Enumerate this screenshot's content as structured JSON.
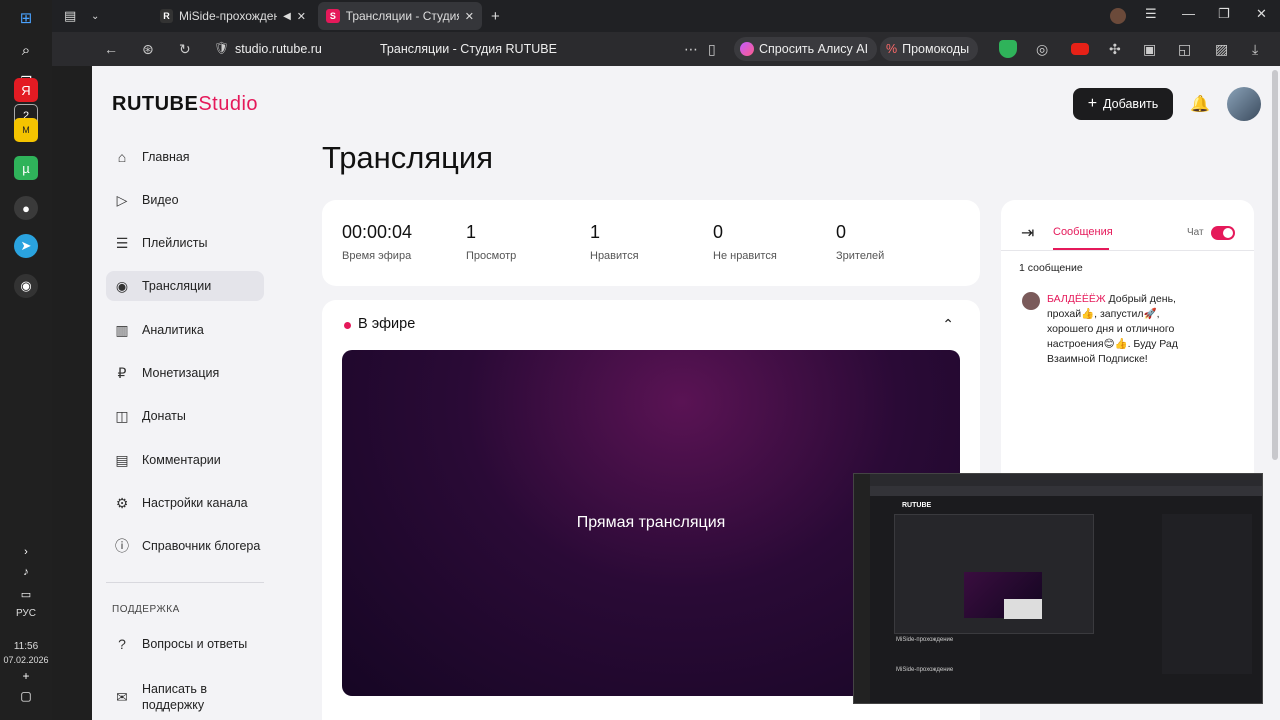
{
  "taskbar": {
    "clock_time": "11:56",
    "clock_date": "07.02.2026",
    "language": "РУС",
    "badge_count": "2"
  },
  "browser": {
    "tabs": [
      {
        "label": "MiSide-прохождение",
        "favicon": "R",
        "active": false
      },
      {
        "label": "Трансляции - Студия RUTUBE",
        "favicon": "S",
        "active": true
      }
    ],
    "url": "studio.rutube.ru",
    "page_title": "Трансляции - Студия RUTUBE",
    "alice_label": "Спросить Алису AI",
    "promo_label": "Промокоды"
  },
  "studio": {
    "logo_main": "RUTUBE",
    "logo_accent": "Studio",
    "add_button": "Добавить",
    "menu": [
      {
        "label": "Главная",
        "icon": "home-icon",
        "glyph": "⌂"
      },
      {
        "label": "Видео",
        "icon": "video-icon",
        "glyph": "▷"
      },
      {
        "label": "Плейлисты",
        "icon": "playlist-icon",
        "glyph": "☰"
      },
      {
        "label": "Трансляции",
        "icon": "broadcast-icon",
        "glyph": "◉",
        "active": true
      },
      {
        "label": "Аналитика",
        "icon": "analytics-icon",
        "glyph": "▥"
      },
      {
        "label": "Монетизация",
        "icon": "monetization-icon",
        "glyph": "₽"
      },
      {
        "label": "Донаты",
        "icon": "donate-icon",
        "glyph": "◫"
      },
      {
        "label": "Комментарии",
        "icon": "comments-icon",
        "glyph": "▤"
      },
      {
        "label": "Настройки канала",
        "icon": "gear-icon",
        "glyph": "⚙"
      },
      {
        "label": "Справочник блогера",
        "icon": "info-icon",
        "glyph": "ⓘ"
      }
    ],
    "support_section": "ПОДДЕРЖКА",
    "support_menu": [
      {
        "label": "Вопросы и ответы",
        "icon": "question-icon",
        "glyph": "?"
      },
      {
        "label": "Написать в поддержку",
        "icon": "mail-icon",
        "glyph": "✉"
      }
    ],
    "page_heading": "Трансляция",
    "stats": [
      {
        "value": "00:00:04",
        "label": "Время эфира"
      },
      {
        "value": "1",
        "label": "Просмотр"
      },
      {
        "value": "1",
        "label": "Нравится"
      },
      {
        "value": "0",
        "label": "Не нравится"
      },
      {
        "value": "0",
        "label": "Зрителей"
      }
    ],
    "live_status": "В эфире",
    "player_text": "Прямая трансляция",
    "chat": {
      "tab_label": "Сообщения",
      "toggle_label": "Чат",
      "message_count": "1 сообщение",
      "messages": [
        {
          "author": "БАЛДЁЁЁЖ",
          "text": "Добрый день, прохай👍, запустил🚀, хорошего дня и отличного настроения😊👍. Буду Рад Взаимной Подписке!"
        }
      ]
    }
  },
  "overlay": {
    "logo": "RUTUBE",
    "caption1": "MiSide-прохождение",
    "caption2": "MiSide-прохождение"
  }
}
